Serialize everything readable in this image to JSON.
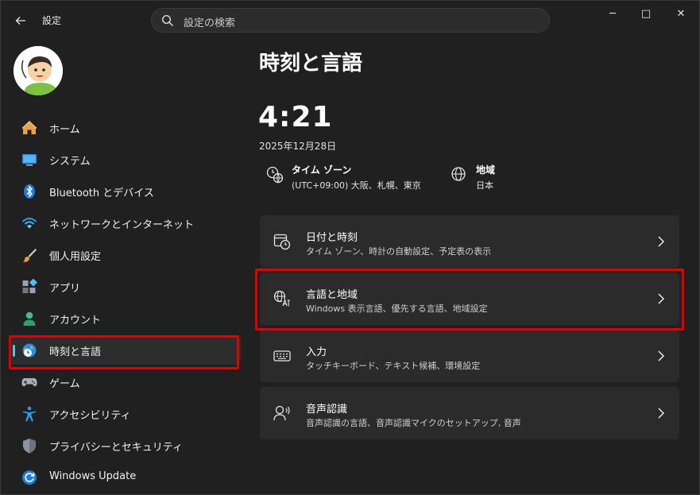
{
  "titlebar": {
    "app_title": "設定",
    "back_icon": "back-arrow-icon"
  },
  "search": {
    "placeholder": "設定の検索",
    "icon": "search-icon"
  },
  "window_controls": {
    "minimize": "─",
    "maximize": "□",
    "close": "✕"
  },
  "sidebar": {
    "items": [
      {
        "label": "ホーム",
        "icon": "home-icon"
      },
      {
        "label": "システム",
        "icon": "system-icon"
      },
      {
        "label": "Bluetooth とデバイス",
        "icon": "bluetooth-icon"
      },
      {
        "label": "ネットワークとインターネット",
        "icon": "network-icon"
      },
      {
        "label": "個人用設定",
        "icon": "personalization-brush-icon"
      },
      {
        "label": "アプリ",
        "icon": "apps-icon"
      },
      {
        "label": "アカウント",
        "icon": "account-icon"
      },
      {
        "label": "時刻と言語",
        "icon": "time-language-icon",
        "selected": true
      },
      {
        "label": "ゲーム",
        "icon": "gaming-controller-icon"
      },
      {
        "label": "アクセシビリティ",
        "icon": "accessibility-icon"
      },
      {
        "label": "プライバシーとセキュリティ",
        "icon": "privacy-shield-icon"
      },
      {
        "label": "Windows Update",
        "icon": "windows-update-icon"
      }
    ]
  },
  "main": {
    "page_title": "時刻と言語",
    "clock": "4:21",
    "date": "2025年12月28日",
    "timezone": {
      "label": "タイム ゾーン",
      "value": "(UTC+09:00) 大阪、札幌、東京",
      "icon": "timezone-globe-clock-icon"
    },
    "region": {
      "label": "地域",
      "value": "日本",
      "icon": "globe-icon"
    },
    "cards": [
      {
        "title": "日付と時刻",
        "subtitle": "タイム ゾーン、時計の自動設定、予定表の表示",
        "icon": "calendar-clock-icon"
      },
      {
        "title": "言語と地域",
        "subtitle": "Windows 表示言語、優先する言語、地域設定",
        "icon": "language-globe-icon",
        "highlighted": true
      },
      {
        "title": "入力",
        "subtitle": "タッチキーボード、テキスト候補、環境設定",
        "icon": "keyboard-icon"
      },
      {
        "title": "音声認識",
        "subtitle": "音声認識の言語、音声認識マイクのセットアップ, 音声",
        "icon": "speech-icon"
      }
    ]
  },
  "colors": {
    "accent": "#4cc2ff",
    "highlight": "#e00000",
    "background": "#202020",
    "card": "#2b2b2b"
  }
}
